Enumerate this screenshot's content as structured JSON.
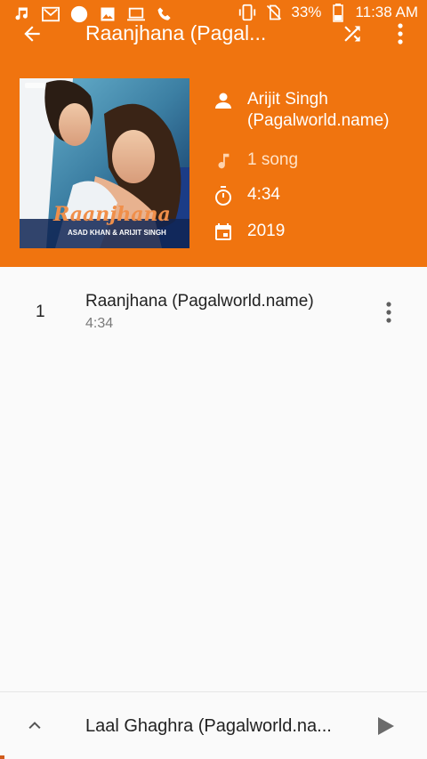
{
  "status_bar": {
    "battery_percent": "33%",
    "time": "11:38 AM"
  },
  "toolbar": {
    "title": "Raanjhana (Pagal..."
  },
  "album": {
    "art_title_text": "Raanjhana",
    "art_artists_text": "ASAD KHAN & ARIJIT SINGH",
    "artist": "Arijit Singh (Pagalworld.name)",
    "song_count": "1 song",
    "duration": "4:34",
    "year": "2019"
  },
  "tracks": [
    {
      "number": "1",
      "title": "Raanjhana (Pagalworld.name)",
      "duration": "4:34"
    }
  ],
  "mini_player": {
    "title": "Laal Ghaghra (Pagalworld.na...",
    "progress": 0.01
  },
  "colors": {
    "header": "#f0740f",
    "background": "#fafafa"
  }
}
